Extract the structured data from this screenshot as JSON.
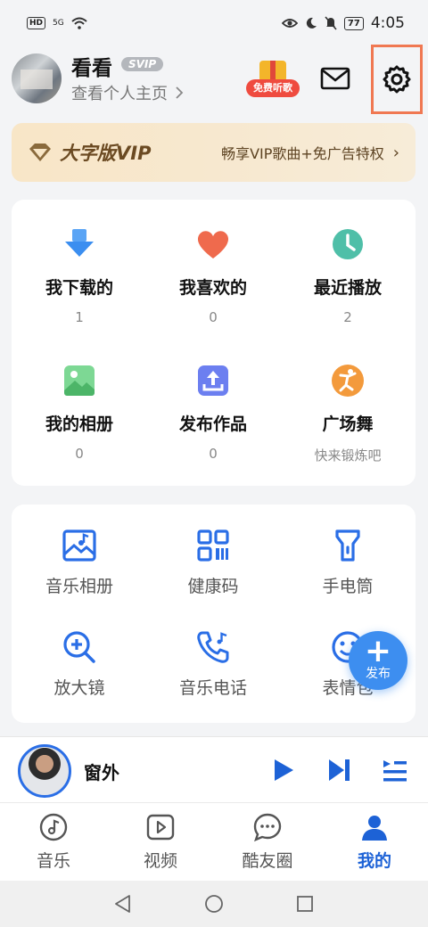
{
  "status_bar": {
    "hd": "HD",
    "signal": "5G",
    "battery": "77",
    "time": "4:05"
  },
  "header": {
    "username": "看看",
    "badge": "SVIP",
    "profile_link": "查看个人主页",
    "gift_label": "免费听歌"
  },
  "vip_banner": {
    "title": "大字版VIP",
    "description": "畅享VIP歌曲+免广告特权"
  },
  "library": [
    {
      "label": "我下载的",
      "count": "1",
      "icon": "download-icon",
      "color": "#3b8ef0"
    },
    {
      "label": "我喜欢的",
      "count": "0",
      "icon": "heart-icon",
      "color": "#ef6a4d"
    },
    {
      "label": "最近播放",
      "count": "2",
      "icon": "clock-icon",
      "color": "#4fbfa8"
    },
    {
      "label": "我的相册",
      "count": "0",
      "icon": "photo-icon",
      "color": "#5cc97a"
    },
    {
      "label": "发布作品",
      "count": "0",
      "icon": "upload-icon",
      "color": "#6c7ff0"
    },
    {
      "label": "广场舞",
      "count": "快来锻炼吧",
      "icon": "dance-icon",
      "color": "#f39a3c"
    }
  ],
  "tools": [
    {
      "label": "音乐相册",
      "icon": "music-album-icon"
    },
    {
      "label": "健康码",
      "icon": "qr-code-icon"
    },
    {
      "label": "手电筒",
      "icon": "flashlight-icon"
    },
    {
      "label": "放大镜",
      "icon": "magnifier-icon"
    },
    {
      "label": "音乐电话",
      "icon": "music-phone-icon"
    },
    {
      "label": "表情包",
      "icon": "emoji-icon"
    }
  ],
  "fab": {
    "label": "发布"
  },
  "player": {
    "title": "窗外"
  },
  "tabs": [
    {
      "label": "音乐",
      "icon": "music-tab-icon"
    },
    {
      "label": "视频",
      "icon": "video-tab-icon"
    },
    {
      "label": "酷友圈",
      "icon": "chat-tab-icon"
    },
    {
      "label": "我的",
      "icon": "profile-tab-icon",
      "active": true
    }
  ],
  "colors": {
    "accent": "#1d62d6",
    "tool_blue": "#2a6ee6",
    "highlight_border": "#f07852"
  }
}
